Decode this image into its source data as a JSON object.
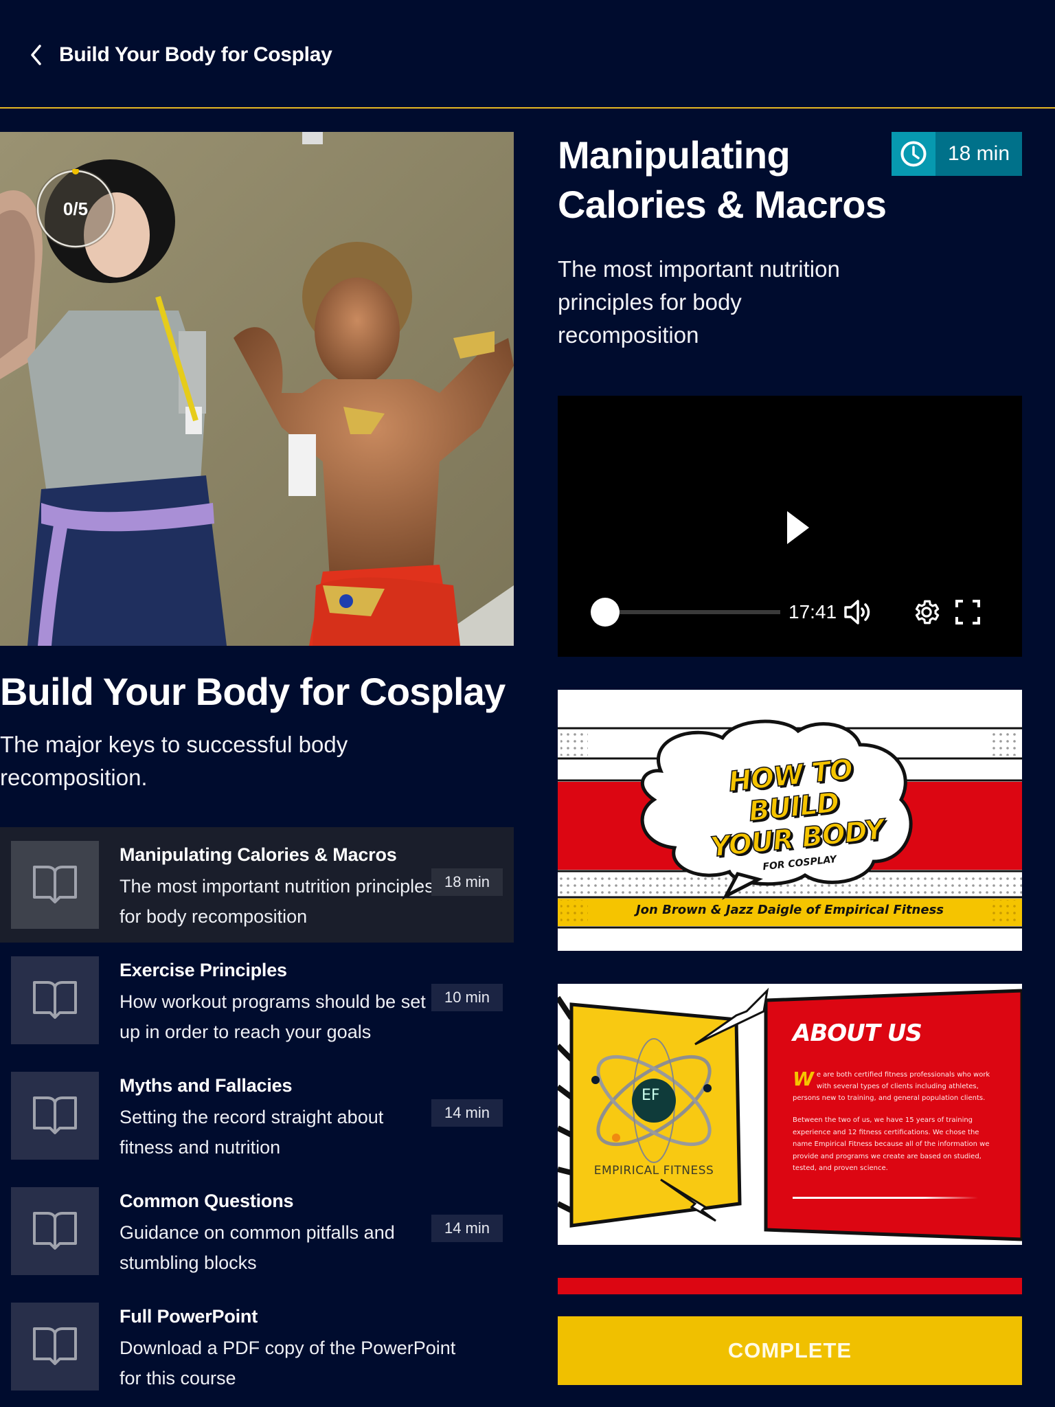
{
  "header": {
    "title": "Build Your Body for Cosplay",
    "back_icon": "chevron-left-icon"
  },
  "course": {
    "progress_label": "0/5",
    "progress": {
      "completed": 0,
      "total": 5
    },
    "title": "Build Your Body for Cosplay",
    "description": "The major keys to successful body recomposition.",
    "hero_image_alt": "Two cosplayers flexing in costume"
  },
  "lessons": [
    {
      "title": "Manipulating Calories & Macros",
      "description": "The most important nutrition principles for body recomposition",
      "duration": "18 min",
      "active": true,
      "icon": "book-icon"
    },
    {
      "title": "Exercise Principles",
      "description": "How workout programs should be set up in order to reach your goals",
      "duration": "10 min",
      "active": false,
      "icon": "book-icon"
    },
    {
      "title": "Myths and Fallacies",
      "description": "Setting the record straight about fitness and nutrition",
      "duration": "14 min",
      "active": false,
      "icon": "book-icon"
    },
    {
      "title": "Common Questions",
      "description": "Guidance on common pitfalls and stumbling blocks",
      "duration": "14 min",
      "active": false,
      "icon": "book-icon"
    },
    {
      "title": "Full PowerPoint",
      "description": "Download a PDF copy of the PowerPoint for this course",
      "duration": "",
      "active": false,
      "icon": "book-icon"
    }
  ],
  "current_lesson": {
    "title": "Manipulating Calories & Macros",
    "description": "The most important nutrition principles for body recomposition",
    "duration": "18 min",
    "duration_icon": "clock-icon"
  },
  "video": {
    "time_remaining": "17:41",
    "progress_fraction": 0,
    "controls": [
      "play-icon",
      "volume-icon",
      "gear-icon",
      "fullscreen-icon"
    ]
  },
  "slides": {
    "cover": {
      "headline_line1": "HOW TO BUILD",
      "headline_line2": "YOUR BODY",
      "subtitle": "FOR COSPLAY",
      "byline": "Jon Brown & Jazz Daigle of Empirical Fitness"
    },
    "about": {
      "logo_initials": "EF",
      "logo_text": "EMPIRICAL FITNESS",
      "heading": "ABOUT US",
      "drop_cap": "W",
      "para1": "e are both certified fitness professionals who work with several types of clients including athletes, persons new to training, and general population clients.",
      "para2": "Between the two of us, we have 15 years of training experience and 12 fitness certifications.  We chose the name Empirical Fitness because all of the information we provide and programs we create are based on studied, tested, and proven science."
    }
  },
  "actions": {
    "complete_label": "COMPLETE"
  },
  "colors": {
    "background": "#000c2e",
    "accent_gold": "#e8b923",
    "complete_yellow": "#f0c000",
    "brand_red": "#dc0612",
    "badge_teal": "#0799b0",
    "badge_teal_dark": "#00718a"
  }
}
